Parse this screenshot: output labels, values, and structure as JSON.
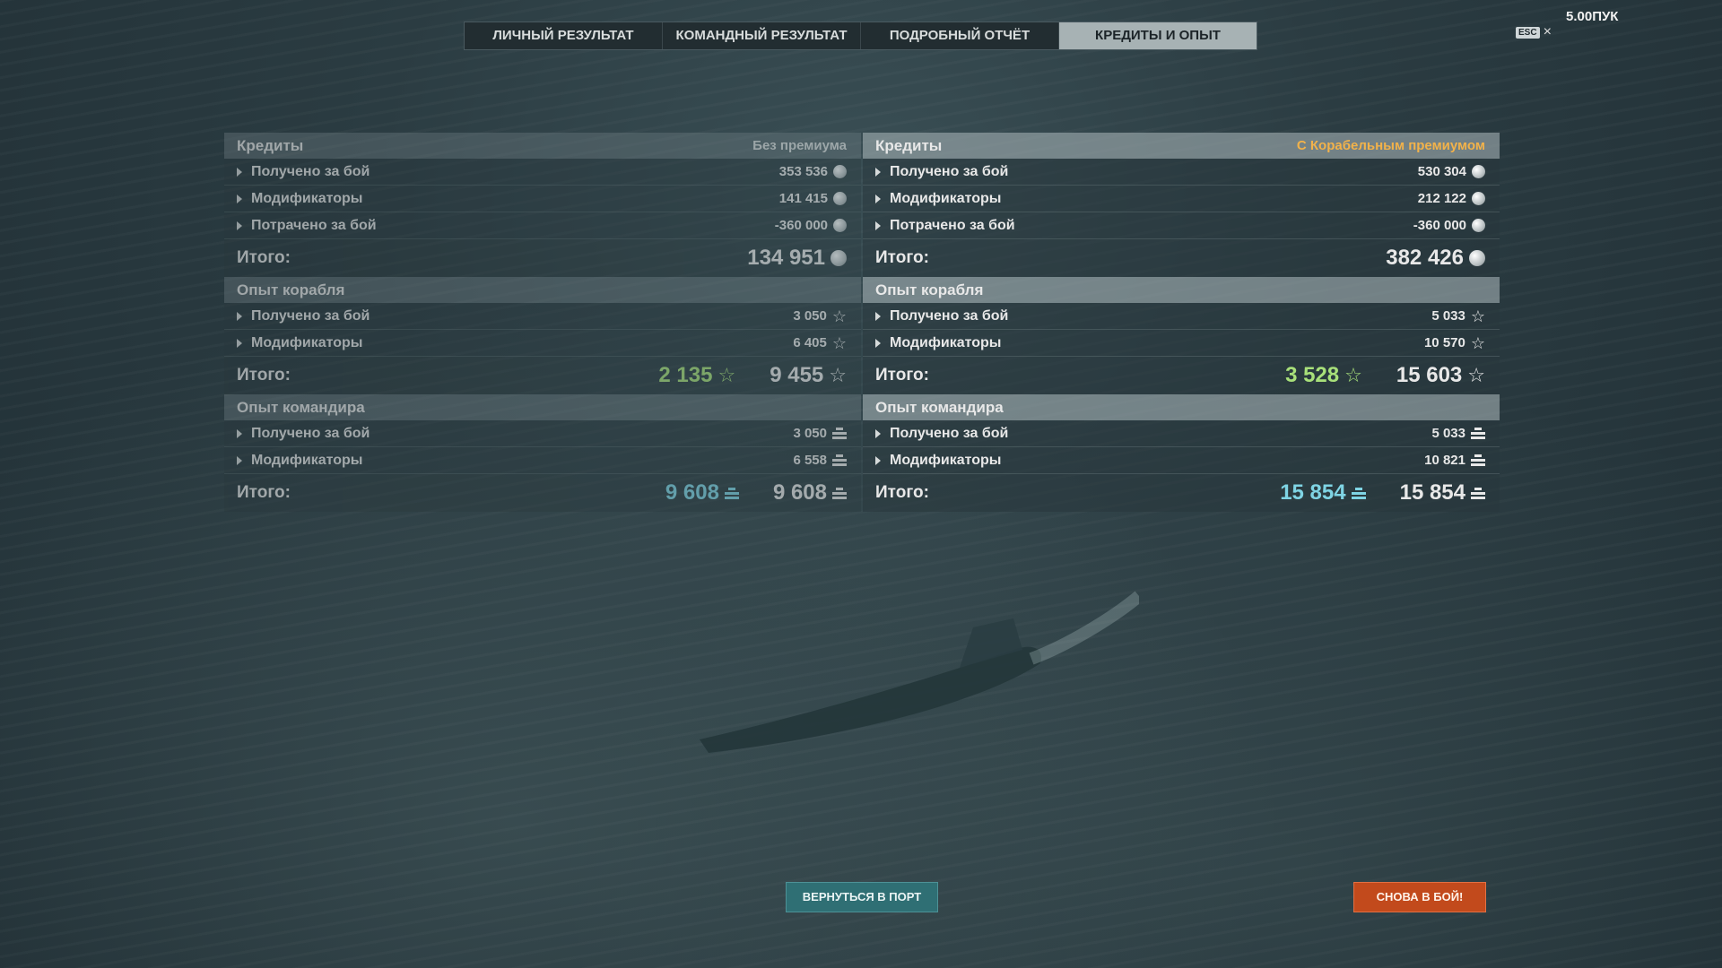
{
  "version": "5.00ПУК",
  "esc": {
    "key": "ESC",
    "close": "×"
  },
  "tabs": [
    {
      "label": "ЛИЧНЫЙ РЕЗУЛЬТАТ",
      "active": false
    },
    {
      "label": "КОМАНДНЫЙ РЕЗУЛЬТАТ",
      "active": false
    },
    {
      "label": "ПОДРОБНЫЙ ОТЧЁТ",
      "active": false
    },
    {
      "label": "КРЕДИТЫ И ОПЫТ",
      "active": true
    }
  ],
  "left": {
    "credits": {
      "title": "Кредиты",
      "subtitle": "Без премиума",
      "rows": [
        {
          "label": "Получено за бой",
          "value": "353 536"
        },
        {
          "label": "Модификаторы",
          "value": "141 415"
        },
        {
          "label": "Потрачено за бой",
          "value": "-360 000"
        }
      ],
      "total_label": "Итого:",
      "total": "134 951"
    },
    "ship_xp": {
      "title": "Опыт корабля",
      "rows": [
        {
          "label": "Получено за бой",
          "value": "3 050"
        },
        {
          "label": "Модификаторы",
          "value": "6 405"
        }
      ],
      "total_label": "Итого:",
      "total_free": "2 135",
      "total": "9 455"
    },
    "commander_xp": {
      "title": "Опыт командира",
      "rows": [
        {
          "label": "Получено за бой",
          "value": "3 050"
        },
        {
          "label": "Модификаторы",
          "value": "6 558"
        }
      ],
      "total_label": "Итого:",
      "total_free": "9 608",
      "total": "9 608"
    }
  },
  "right": {
    "credits": {
      "title": "Кредиты",
      "subtitle": "С Корабельным премиумом",
      "rows": [
        {
          "label": "Получено за бой",
          "value": "530 304"
        },
        {
          "label": "Модификаторы",
          "value": "212 122"
        },
        {
          "label": "Потрачено за бой",
          "value": "-360 000"
        }
      ],
      "total_label": "Итого:",
      "total": "382 426"
    },
    "ship_xp": {
      "title": "Опыт корабля",
      "rows": [
        {
          "label": "Получено за бой",
          "value": "5 033"
        },
        {
          "label": "Модификаторы",
          "value": "10 570"
        }
      ],
      "total_label": "Итого:",
      "total_free": "3 528",
      "total": "15 603"
    },
    "commander_xp": {
      "title": "Опыт командира",
      "rows": [
        {
          "label": "Получено за бой",
          "value": "5 033"
        },
        {
          "label": "Модификаторы",
          "value": "10 821"
        }
      ],
      "total_label": "Итого:",
      "total_free": "15 854",
      "total": "15 854"
    }
  },
  "buttons": {
    "port": "ВЕРНУТЬСЯ В ПОРТ",
    "battle": "СНОВА В БОЙ!"
  },
  "colors": {
    "premium_gold": "#f2b24a",
    "free_xp_green": "#a8e07a",
    "commander_xp_teal": "#7fd4e4",
    "battle_button": "#c24a1c",
    "port_button": "#2f6f74"
  }
}
